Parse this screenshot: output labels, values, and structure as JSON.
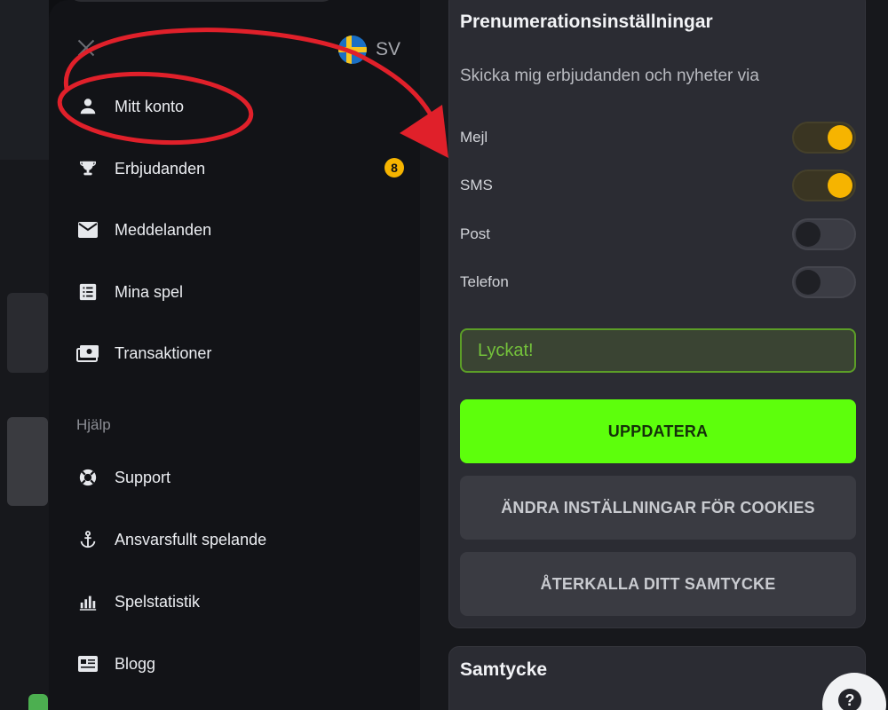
{
  "drawer": {
    "language_code": "SV",
    "items_main": [
      {
        "label": "Mitt konto",
        "icon": "person-icon"
      },
      {
        "label": "Erbjudanden",
        "icon": "trophy-icon",
        "badge": "8"
      },
      {
        "label": "Meddelanden",
        "icon": "mail-icon"
      },
      {
        "label": "Mina spel",
        "icon": "list-icon"
      },
      {
        "label": "Transaktioner",
        "icon": "cash-icon"
      }
    ],
    "help_section": "Hjälp",
    "items_help": [
      {
        "label": "Support",
        "icon": "lifebuoy-icon"
      },
      {
        "label": "Ansvarsfullt spelande",
        "icon": "anchor-icon"
      },
      {
        "label": "Spelstatistik",
        "icon": "bar-chart-icon"
      },
      {
        "label": "Blogg",
        "icon": "news-icon"
      }
    ]
  },
  "subscription": {
    "title": "Prenumerationsinställningar",
    "subtitle": "Skicka mig erbjudanden och nyheter via",
    "options": [
      {
        "label": "Mejl",
        "on": true
      },
      {
        "label": "SMS",
        "on": true
      },
      {
        "label": "Post",
        "on": false
      },
      {
        "label": "Telefon",
        "on": false
      }
    ],
    "success_message": "Lyckat!",
    "update_button": "UPPDATERA",
    "cookies_button": "ÄNDRA INSTÄLLNINGAR FÖR COOKIES",
    "revoke_button": "ÅTERKALLA DITT SAMTYCKE"
  },
  "consent": {
    "title": "Samtycke"
  },
  "colors": {
    "accent_yellow": "#f6b400",
    "primary_green": "#5dff0c",
    "annotation_red": "#e0202a",
    "success_green": "#74c23b"
  },
  "chat_widget": {
    "glyph": "?"
  }
}
